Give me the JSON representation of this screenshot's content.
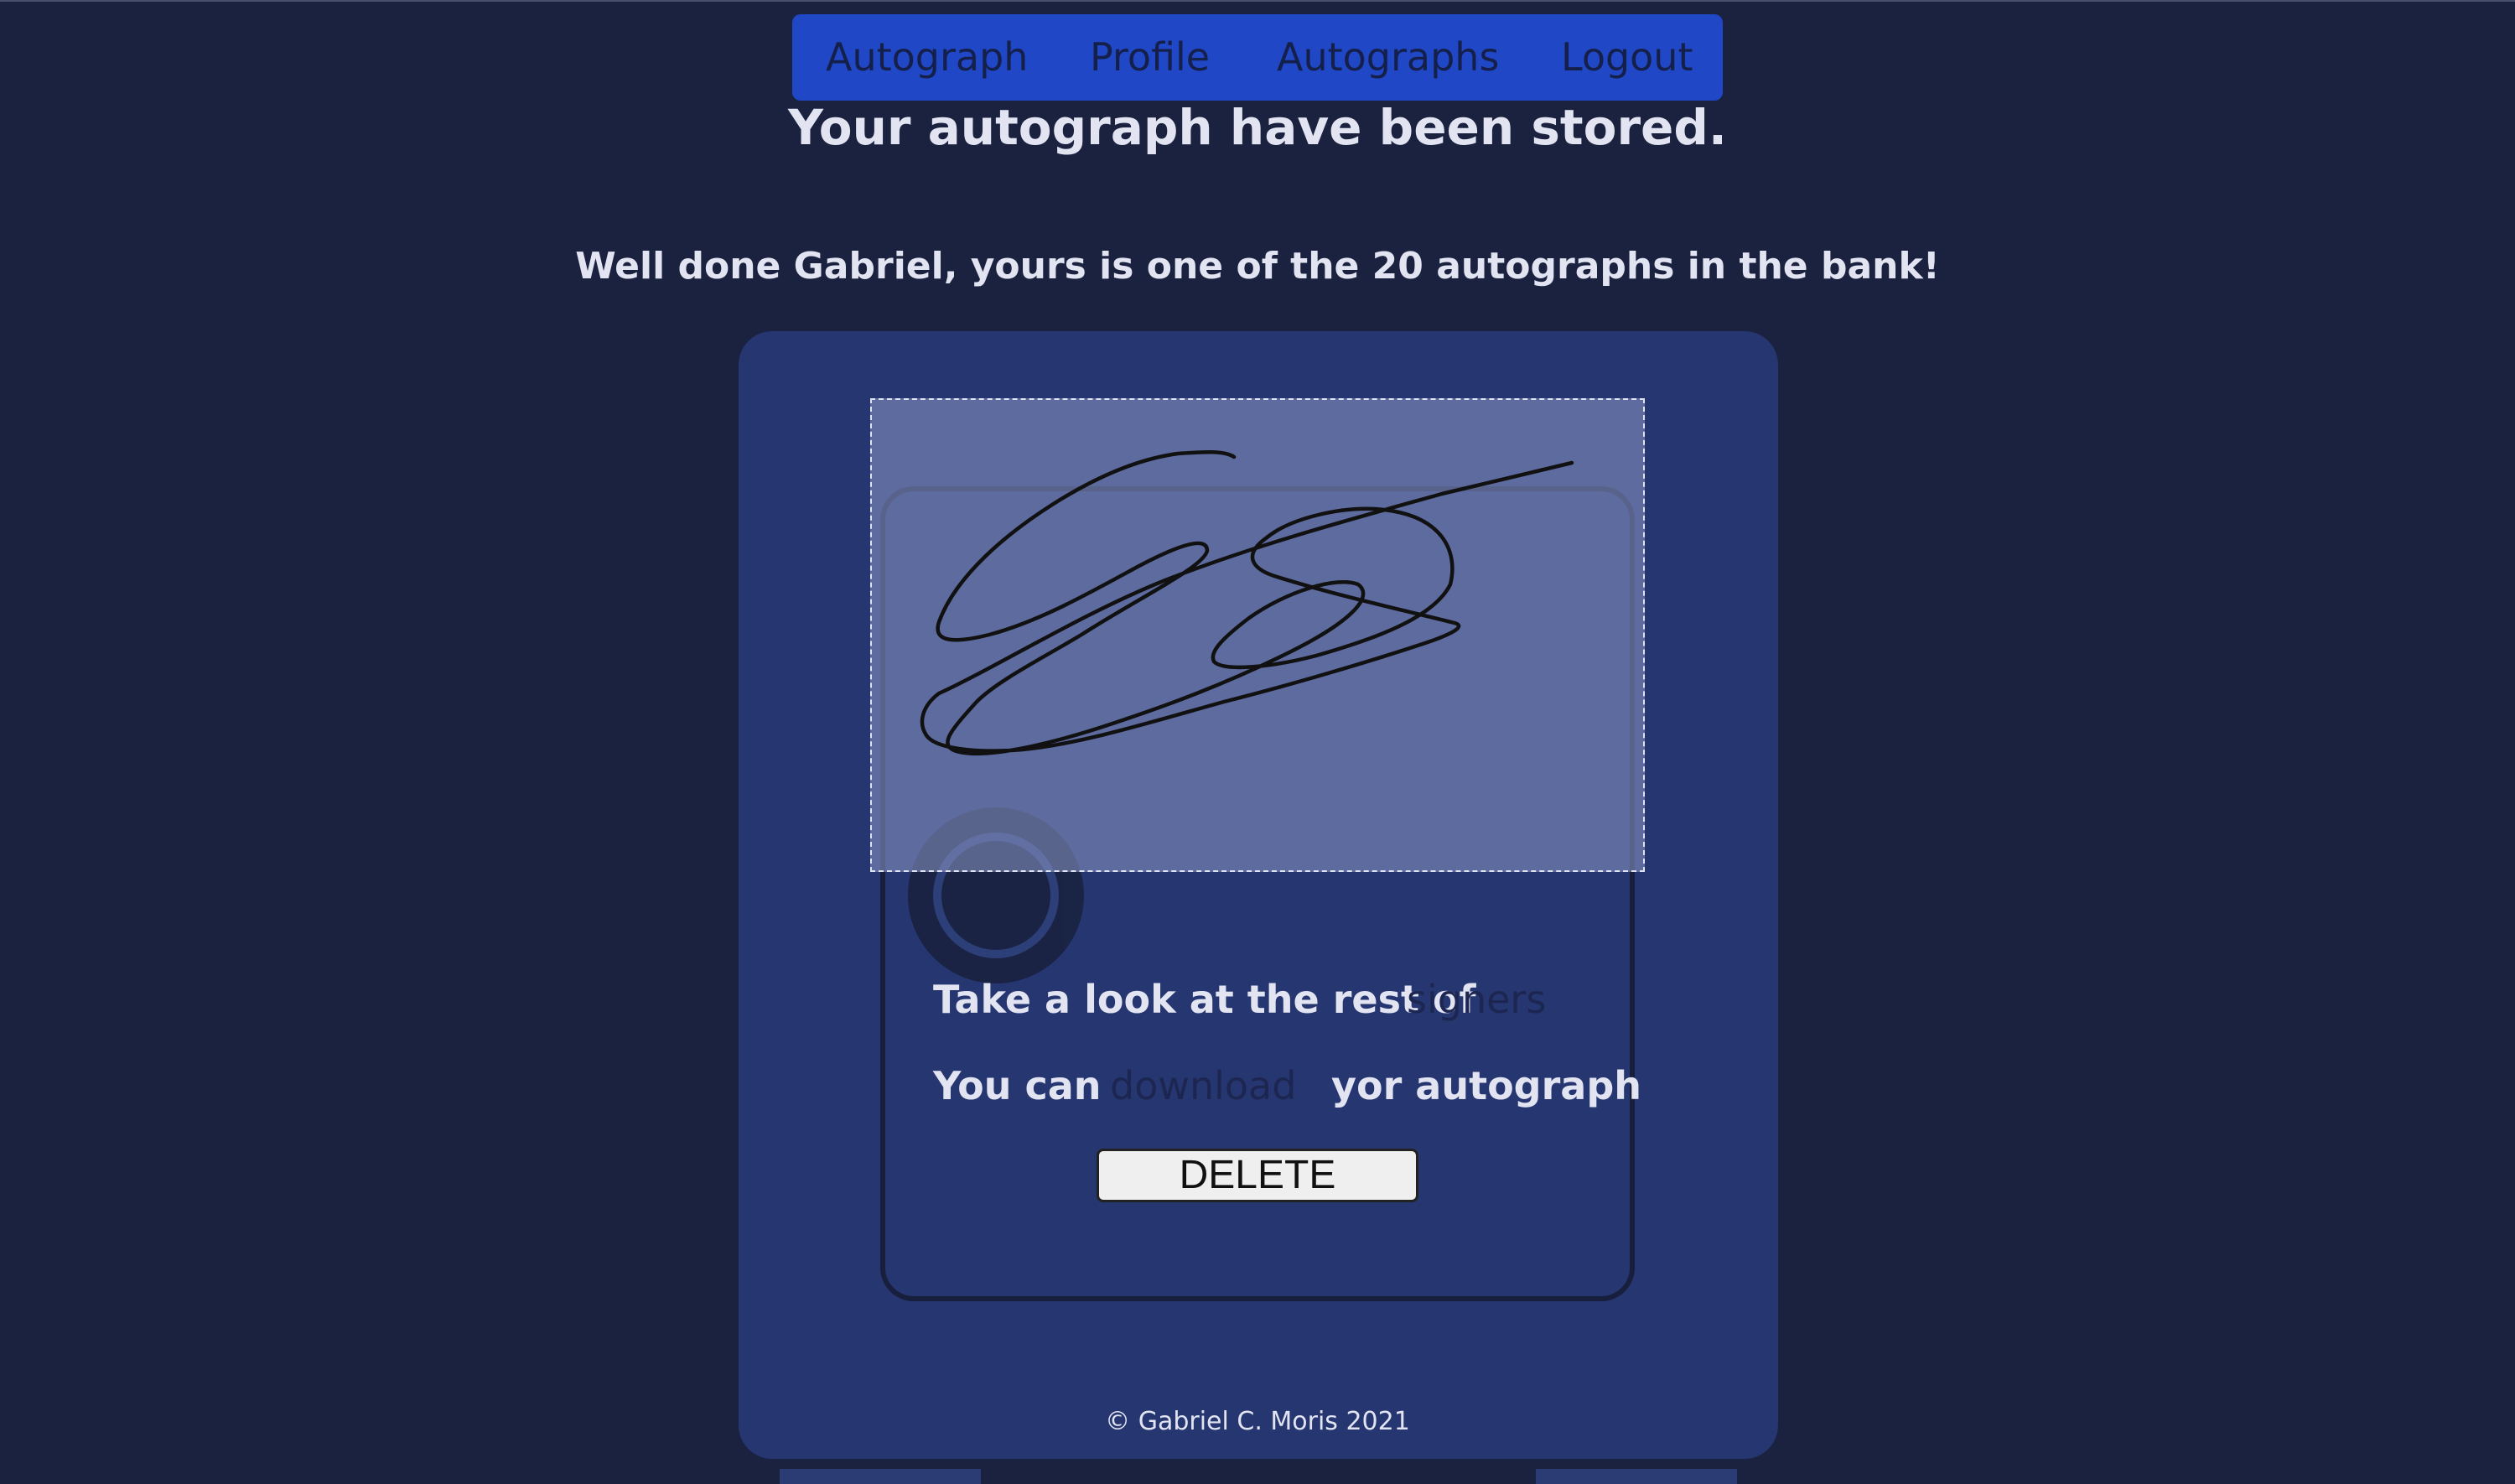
{
  "nav": {
    "items": [
      "Autograph",
      "Profile",
      "Autographs",
      "Logout"
    ]
  },
  "status": {
    "title": "Your autograph have been stored.",
    "message": "Well done Gabriel, yours is one of the 20 autographs in the bank!"
  },
  "card": {
    "signers_prefix": "Take a look at the rest of",
    "signers_link": "signers",
    "download_prefix": "You can",
    "download_link": "download",
    "download_suffix": "yor autograph",
    "delete_label": "DELETE"
  },
  "footer": {
    "copyright": "© Gabriel C. Moris 2021"
  },
  "colors": {
    "background": "#1a2240",
    "nav_bar": "#2047c6",
    "card": "#253670",
    "text": "#e2e4f2",
    "link": "#1c2650"
  }
}
